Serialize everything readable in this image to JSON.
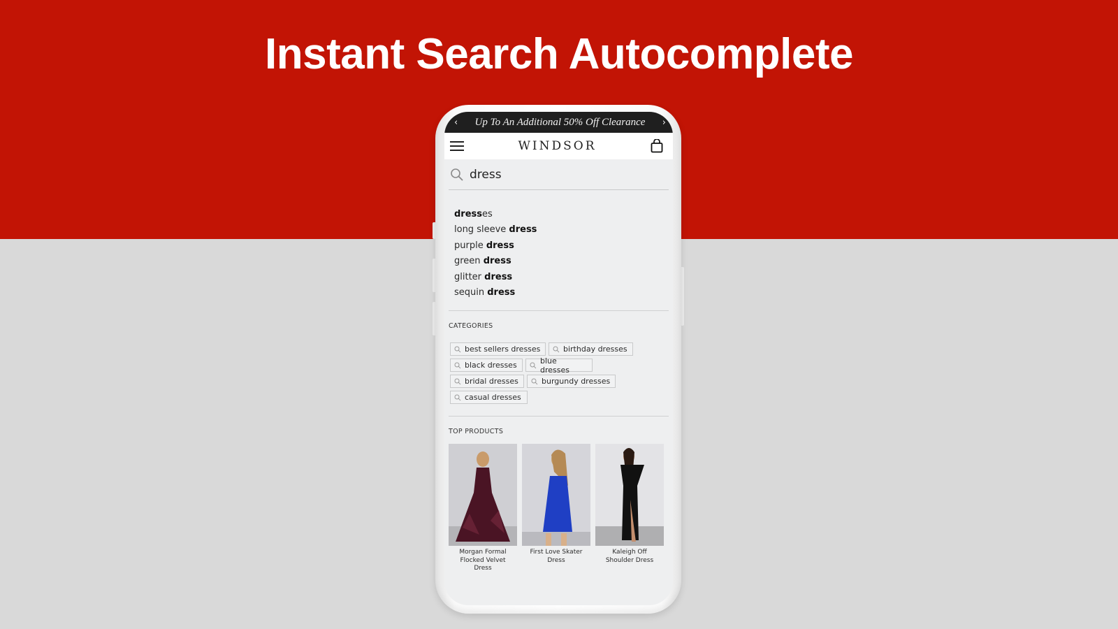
{
  "hero": {
    "title": "Instant Search Autocomplete"
  },
  "colors": {
    "brand_red": "#c21405",
    "promo_bg": "#1f1f1f",
    "screen_bg": "#eeeff0"
  },
  "promo_bar": {
    "prev_icon": "chevron-left-icon",
    "text": "Up To An Additional 50% Off Clearance",
    "next_icon": "chevron-right-icon",
    "prev_glyph": "‹",
    "next_glyph": "›"
  },
  "nav": {
    "menu_icon": "hamburger-menu-icon",
    "logo": "WINDSOR",
    "cart_icon": "shopping-bag-icon"
  },
  "search": {
    "icon": "search-icon",
    "value": "dress",
    "placeholder": ""
  },
  "suggestions": [
    {
      "pre": "",
      "bold": "dress",
      "post": "es"
    },
    {
      "pre": "long sleeve ",
      "bold": "dress",
      "post": ""
    },
    {
      "pre": "purple ",
      "bold": "dress",
      "post": ""
    },
    {
      "pre": "green ",
      "bold": "dress",
      "post": ""
    },
    {
      "pre": "glitter ",
      "bold": "dress",
      "post": ""
    },
    {
      "pre": "sequin ",
      "bold": "dress",
      "post": ""
    }
  ],
  "categories": {
    "label": "CATEGORIES",
    "items": [
      "best sellers dresses",
      "birthday dresses",
      "black dresses",
      "blue dresses",
      "bridal dresses",
      "burgundy dresses",
      "casual dresses"
    ]
  },
  "top_products": {
    "label": "TOP PRODUCTS",
    "items": [
      {
        "name": "Morgan Formal Flocked Velvet Dress",
        "dress_color": "#4a1424"
      },
      {
        "name": "First Love Skater Dress",
        "dress_color": "#1f3fc4"
      },
      {
        "name": "Kaleigh Off Shoulder Dress",
        "dress_color": "#111111"
      }
    ]
  }
}
